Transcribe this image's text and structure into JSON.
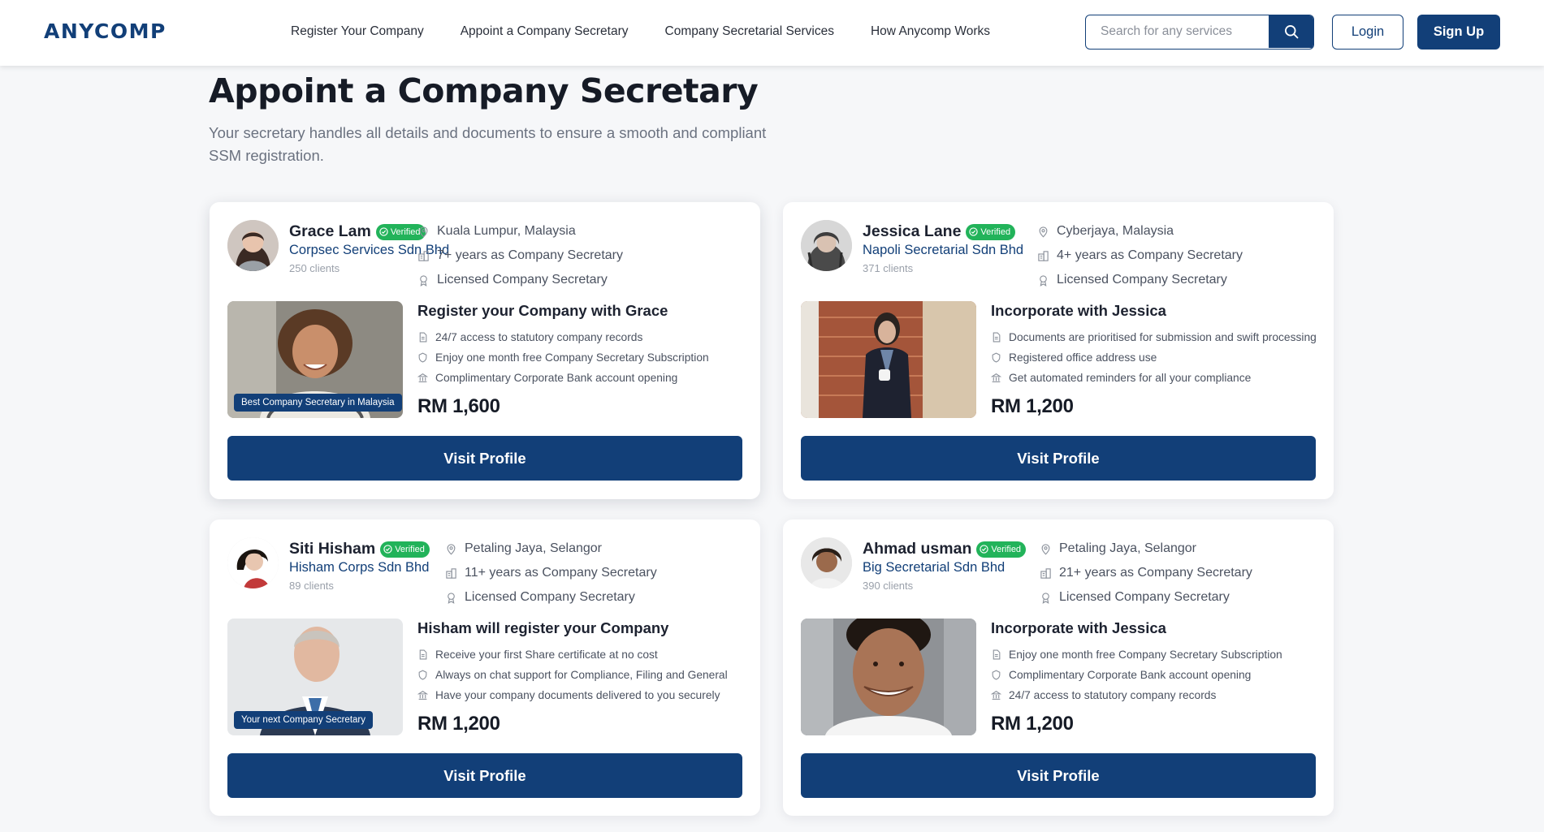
{
  "header": {
    "logo": "ANYCOMP",
    "nav": [
      "Register Your Company",
      "Appoint a Company Secretary",
      "Company Secretarial Services",
      "How Anycomp Works"
    ],
    "search_placeholder": "Search for any services",
    "login": "Login",
    "signup": "Sign Up"
  },
  "page": {
    "title": "Appoint a Company Secretary",
    "subtitle": "Your secretary handles all details and documents to ensure a smooth and compliant SSM registration."
  },
  "verified_label": "Verified",
  "cards": [
    {
      "name": "Grace Lam",
      "company": "Corpsec Services Sdn Bhd",
      "clients": "250 clients",
      "location": "Kuala Lumpur, Malaysia",
      "experience": "7+ years as Company Secretary",
      "license": "Licensed Company Secretary",
      "offer_title": "Register your Company with Grace",
      "features": [
        "24/7 access to statutory company records",
        "Enjoy one month free Company Secretary Subscription",
        "Complimentary Corporate Bank account opening"
      ],
      "price": "RM 1,600",
      "photo_tag": "Best Company Secretary in Malaysia",
      "button": "Visit Profile"
    },
    {
      "name": "Jessica Lane",
      "company": "Napoli Secretarial Sdn Bhd",
      "clients": "371 clients",
      "location": "Cyberjaya, Malaysia",
      "experience": "4+ years as Company Secretary",
      "license": "Licensed Company Secretary",
      "offer_title": "Incorporate with Jessica",
      "features": [
        "Documents are prioritised for submission and swift processing",
        "Registered office address use",
        "Get automated reminders for all your compliance"
      ],
      "price": "RM 1,200",
      "photo_tag": "",
      "button": "Visit Profile"
    },
    {
      "name": "Siti Hisham",
      "company": "Hisham Corps Sdn Bhd",
      "clients": "89 clients",
      "location": "Petaling Jaya, Selangor",
      "experience": "11+ years as Company Secretary",
      "license": "Licensed Company Secretary",
      "offer_title": "Hisham will register your Company",
      "features": [
        "Receive your first Share certificate at no cost",
        "Always on chat support for Compliance, Filing and General",
        "Have your company documents delivered to you securely"
      ],
      "price": "RM 1,200",
      "photo_tag": "Your next Company Secretary",
      "button": "Visit Profile"
    },
    {
      "name": "Ahmad usman",
      "company": "Big Secretarial Sdn Bhd",
      "clients": "390 clients",
      "location": "Petaling Jaya, Selangor",
      "experience": "21+ years as Company Secretary",
      "license": "Licensed Company Secretary",
      "offer_title": "Incorporate with Jessica",
      "features": [
        "Enjoy one month free Company Secretary Subscription",
        "Complimentary Corporate Bank account opening",
        "24/7 access to statutory company records"
      ],
      "price": "RM 1,200",
      "photo_tag": "",
      "button": "Visit Profile"
    }
  ],
  "colors": {
    "brand": "#123f78",
    "verified": "#22b35a",
    "background": "#f6f7f9"
  },
  "icons": {
    "search": "search-icon",
    "location": "location-pin-icon",
    "experience": "building-icon",
    "license": "award-ribbon-icon",
    "feature_1": "document-icon",
    "feature_2": "shield-icon",
    "feature_3": "bank-icon",
    "verified": "check-circle-icon"
  }
}
